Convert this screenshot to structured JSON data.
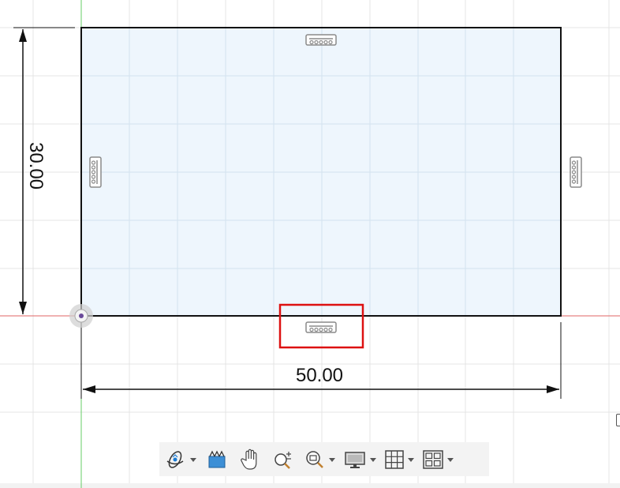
{
  "sketch": {
    "rectangle": {
      "width": 50.0,
      "height": 30.0,
      "fill": "#eef6fd",
      "stroke": "#111111"
    },
    "dimensions": {
      "horizontal_label": "50.00",
      "vertical_label": "30.00"
    },
    "constraints": [
      {
        "type": "horizontal",
        "edge": "top",
        "icon": "horizontal-constraint-icon"
      },
      {
        "type": "horizontal",
        "edge": "bottom",
        "icon": "horizontal-constraint-icon",
        "highlighted": true
      },
      {
        "type": "vertical",
        "edge": "left",
        "icon": "vertical-constraint-icon"
      },
      {
        "type": "vertical",
        "edge": "right",
        "icon": "vertical-constraint-icon"
      }
    ],
    "origin_icon": "origin-point-icon",
    "axis_colors": {
      "x_axis": "#e06666",
      "y_axis": "#66cc66"
    },
    "grid_color": "#e4e4e4",
    "highlight_color": "#dd1111"
  },
  "navigation_bar": {
    "items": [
      {
        "icon": "orbit-icon",
        "has_dropdown": true
      },
      {
        "icon": "look-at-icon",
        "has_dropdown": false
      },
      {
        "icon": "pan-hand-icon",
        "has_dropdown": false
      },
      {
        "icon": "zoom-icon",
        "has_dropdown": false
      },
      {
        "icon": "fit-zoom-window-icon",
        "has_dropdown": true
      },
      {
        "icon": "display-settings-icon",
        "has_dropdown": true
      },
      {
        "icon": "grid-snap-icon",
        "has_dropdown": true
      },
      {
        "icon": "viewports-icon",
        "has_dropdown": true
      }
    ]
  }
}
